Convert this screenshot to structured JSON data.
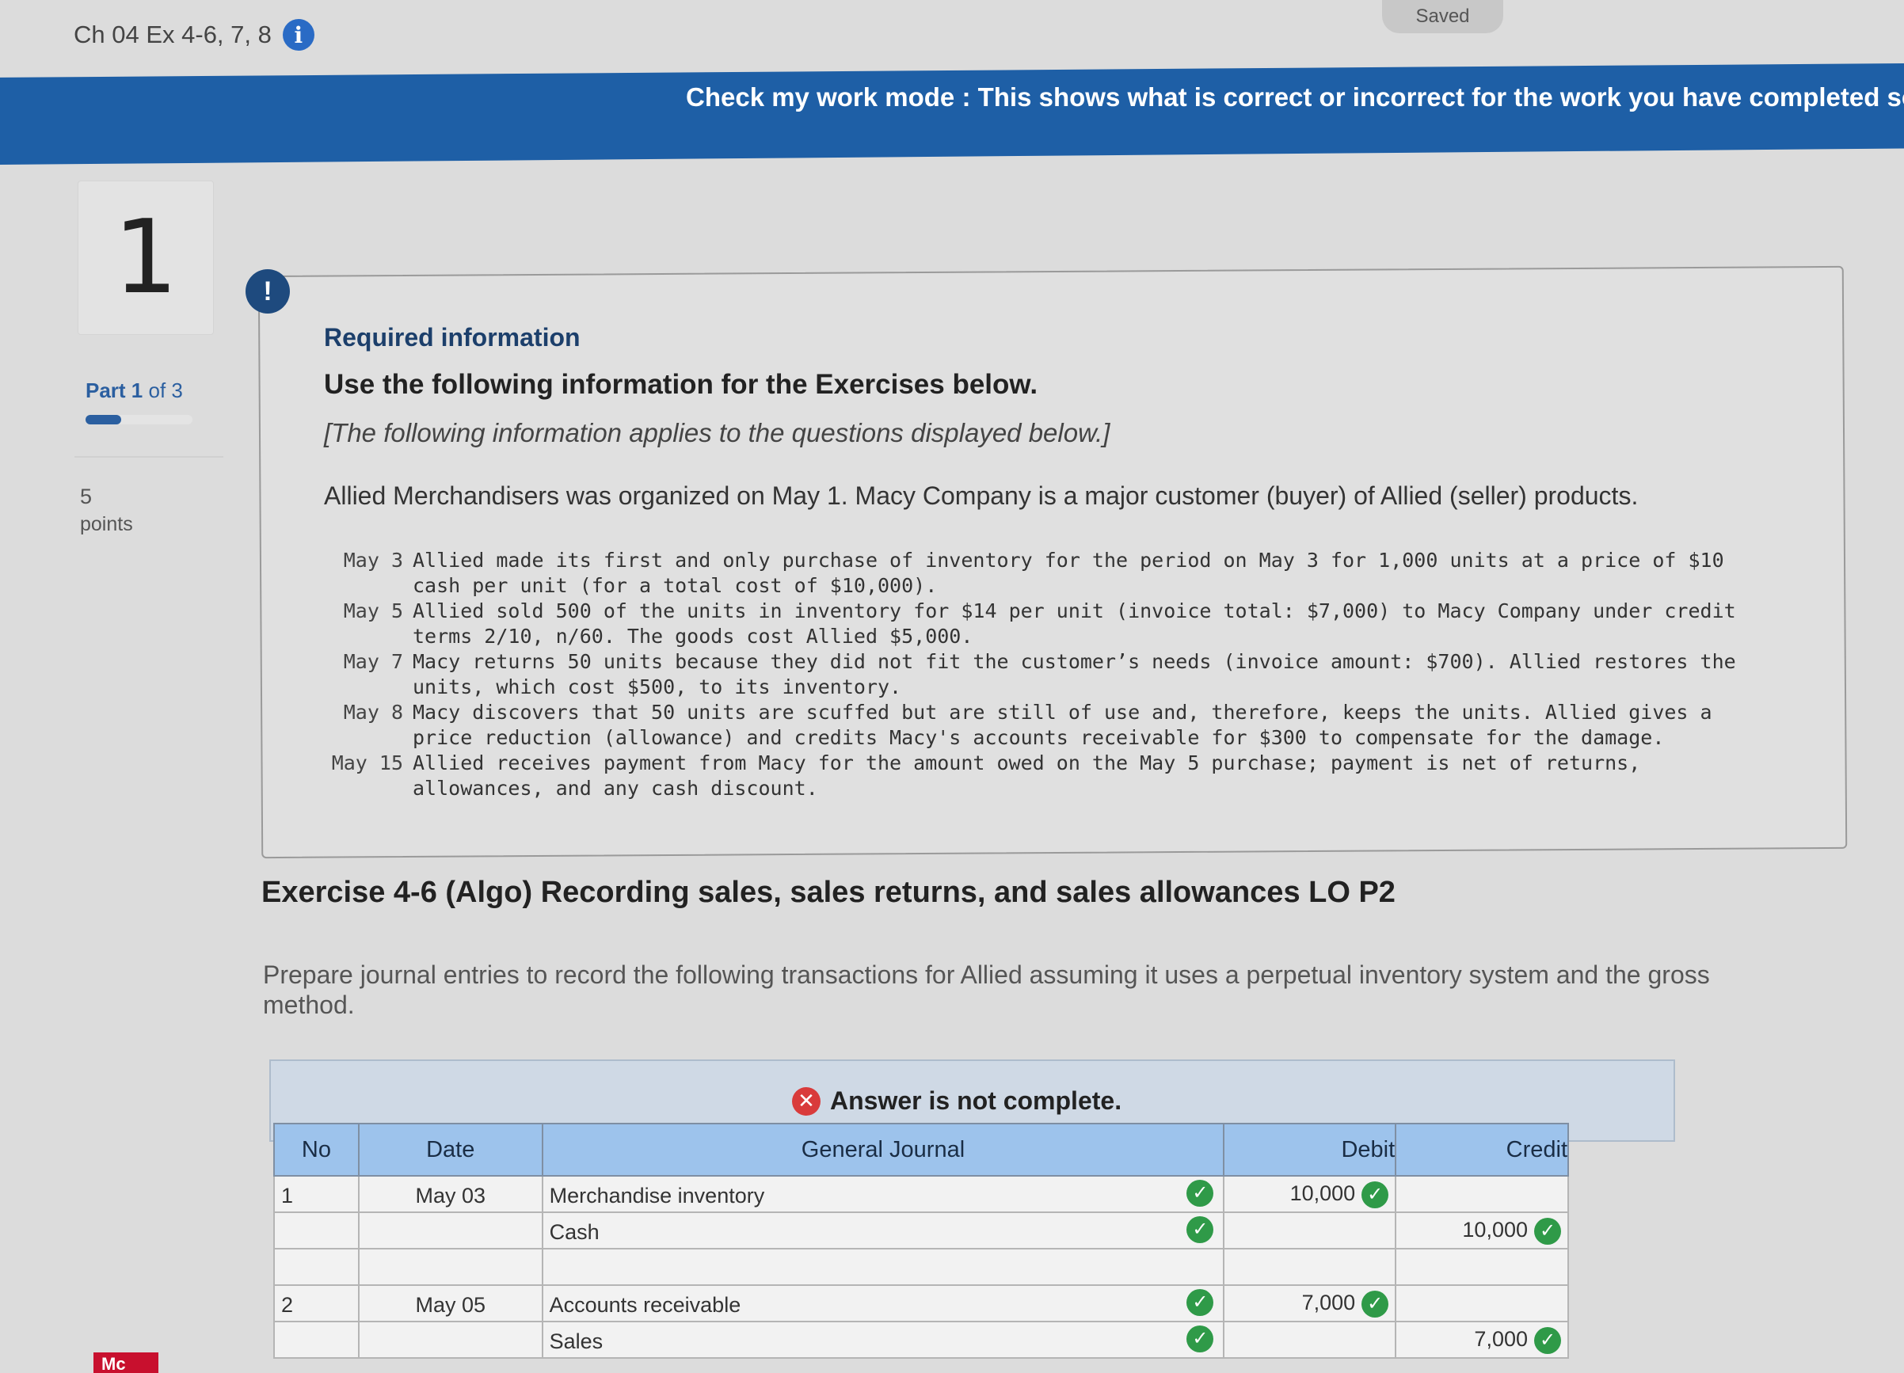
{
  "header": {
    "title": "Ch 04 Ex 4-6, 7, 8",
    "info_icon": "info-icon",
    "saved_label": "Saved"
  },
  "banner": {
    "text": "Check my work mode : This shows what is correct or incorrect for the work you have completed so"
  },
  "sidebar": {
    "question_number": "1",
    "part_label": "Part 1",
    "part_of": " of 3",
    "progress_fraction": 0.33,
    "points_value": "5",
    "points_label": "points",
    "logo_text": "Mc"
  },
  "required_info": {
    "heading": "Required information",
    "subheading": "Use the following information for the Exercises below.",
    "note": "[The following information applies to the questions displayed below.]",
    "intro": "Allied Merchandisers was organized on May 1. Macy Company is a major customer (buyer) of Allied (seller) products.",
    "transactions": [
      {
        "date": "May 3",
        "text": "Allied made its first and only purchase of inventory for the period on May 3 for 1,000 units at a price of $10 cash per unit (for a total cost of $10,000)."
      },
      {
        "date": "May 5",
        "text": "Allied sold 500 of the units in inventory for $14 per unit (invoice total: $7,000) to Macy Company under credit terms 2/10, n/60. The goods cost Allied $5,000."
      },
      {
        "date": "May 7",
        "text": "Macy returns 50 units because they did not fit the customer’s needs (invoice amount: $700). Allied restores the units, which cost $500, to its inventory."
      },
      {
        "date": "May 8",
        "text": "Macy discovers that 50 units are scuffed but are still of use and, therefore, keeps the units. Allied gives a price reduction (allowance) and credits Macy's accounts receivable for $300 to compensate for the damage."
      },
      {
        "date": "May 15",
        "text": "Allied receives payment from Macy for the amount owed on the May 5 purchase; payment is net of returns, allowances, and any cash discount."
      }
    ]
  },
  "exercise": {
    "title": "Exercise 4-6 (Algo) Recording sales, sales returns, and sales allowances LO P2",
    "instructions": "Prepare journal entries to record the following transactions for Allied assuming it uses a perpetual inventory system and the gross method."
  },
  "answer": {
    "status": "Answer is not complete.",
    "columns": {
      "no": "No",
      "date": "Date",
      "journal": "General Journal",
      "debit": "Debit",
      "credit": "Credit"
    },
    "rows": [
      {
        "no": "1",
        "date": "May 03",
        "account": "Merchandise inventory",
        "debit": "10,000",
        "credit": ""
      },
      {
        "no": "",
        "date": "",
        "account": "Cash",
        "debit": "",
        "credit": "10,000"
      },
      {
        "no": "",
        "date": "",
        "account": "",
        "debit": "",
        "credit": ""
      },
      {
        "no": "2",
        "date": "May 05",
        "account": "Accounts receivable",
        "debit": "7,000",
        "credit": ""
      },
      {
        "no": "",
        "date": "",
        "account": "Sales",
        "debit": "",
        "credit": "7,000"
      }
    ]
  }
}
